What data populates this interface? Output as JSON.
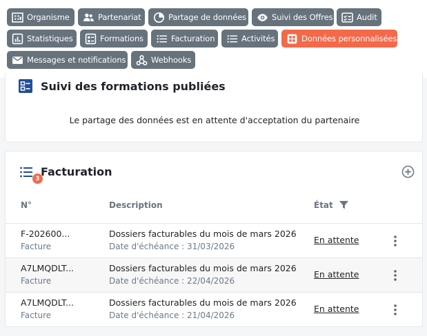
{
  "tabs": [
    {
      "label": "Organisme",
      "icon": "building-icon"
    },
    {
      "label": "Partenariat",
      "icon": "people-icon"
    },
    {
      "label": "Partage de données",
      "icon": "pie-icon"
    },
    {
      "label": "Suivi des Offres",
      "icon": "eye-icon"
    },
    {
      "label": "Audit",
      "icon": "checklist-icon"
    },
    {
      "label": "Statistiques",
      "icon": "bar-chart-icon"
    },
    {
      "label": "Formations",
      "icon": "card-list-icon"
    },
    {
      "label": "Facturation",
      "icon": "list-icon"
    },
    {
      "label": "Activités",
      "icon": "list-icon"
    },
    {
      "label": "Données personnalisées",
      "icon": "grid-icon",
      "active": true
    },
    {
      "label": "Messages et notifications",
      "icon": "mail-icon"
    },
    {
      "label": "Webhooks",
      "icon": "webhook-icon"
    }
  ],
  "formations_section": {
    "title": "Suivi des formations publiées",
    "message": "Le partage des données est en attente d'acceptation du partenaire"
  },
  "billing_section": {
    "title": "Facturation",
    "badge_count": "3",
    "columns": {
      "number": "N°",
      "description": "Description",
      "state": "État"
    },
    "rows": [
      {
        "number": "F-202600...",
        "type": "Facture",
        "description": "Dossiers facturables du mois de mars 2026",
        "due": "Date d'échéance : 31/03/2026",
        "state": "En attente"
      },
      {
        "number": "A7LMQDLT...",
        "type": "Facture",
        "description": "Dossiers facturables du mois de mars 2026",
        "due": "Date d'échéance : 22/04/2026",
        "state": "En attente"
      },
      {
        "number": "A7LMQDLT...",
        "type": "Facture",
        "description": "Dossiers facturables du mois de mars 2026",
        "due": "Date d'échéance : 21/04/2026",
        "state": "En attente"
      }
    ]
  },
  "colors": {
    "chip": "#66727c",
    "active_chip": "#f4694a",
    "accent_blue": "#1f4e9c"
  }
}
